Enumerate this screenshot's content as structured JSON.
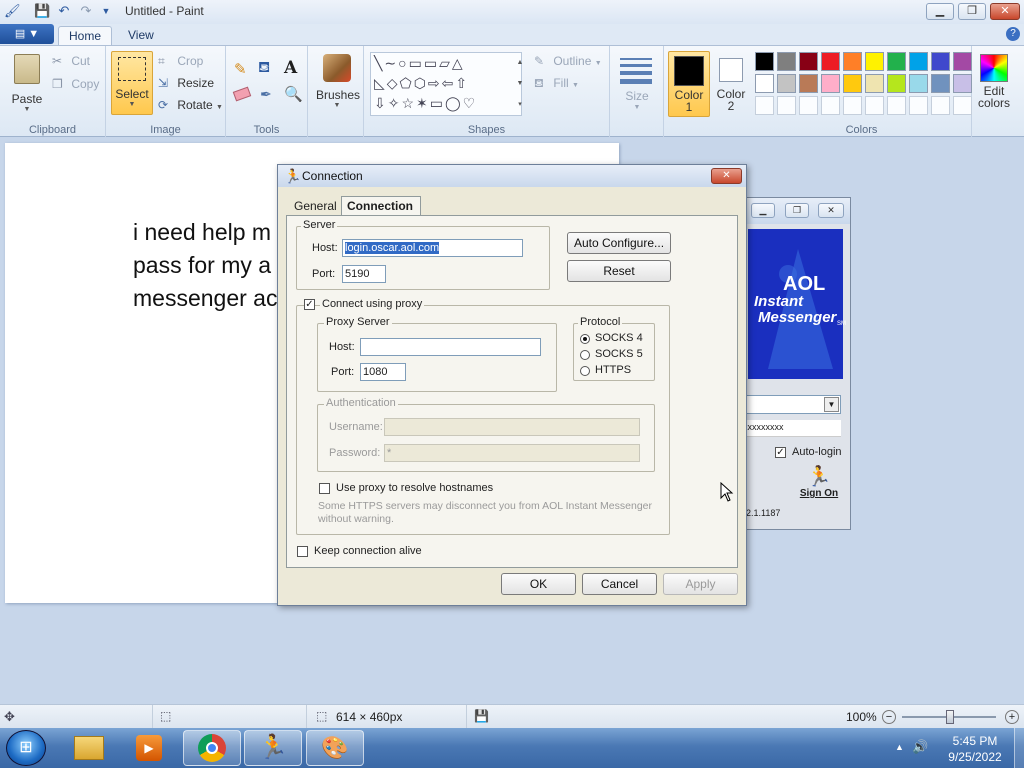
{
  "window": {
    "title": "Untitled - Paint"
  },
  "ribbon": {
    "app_menu": "▼",
    "tabs": [
      "Home",
      "View"
    ],
    "clipboard": {
      "paste": "Paste",
      "cut": "Cut",
      "copy": "Copy",
      "label": "Clipboard"
    },
    "image": {
      "select": "Select",
      "crop": "Crop",
      "resize": "Resize",
      "rotate": "Rotate",
      "label": "Image"
    },
    "tools": {
      "label": "Tools",
      "text_tool": "A"
    },
    "brushes": {
      "label": "Brushes"
    },
    "shapes": {
      "outline": "Outline",
      "fill": "Fill",
      "label": "Shapes"
    },
    "size": {
      "label": "Size"
    },
    "color1": {
      "label1": "Color",
      "label2": "1"
    },
    "color2": {
      "label1": "Color",
      "label2": "2"
    },
    "colors": {
      "label": "Colors",
      "edit1": "Edit",
      "edit2": "colors",
      "row1": [
        "#000000",
        "#7f7f7f",
        "#880015",
        "#ed1c24",
        "#ff7f27",
        "#fff200",
        "#22b14c",
        "#00a2e8",
        "#3f48cc",
        "#a349a4"
      ],
      "row2": [
        "#ffffff",
        "#c3c3c3",
        "#b97a57",
        "#ffaec9",
        "#ffc90e",
        "#efe4b0",
        "#b5e61d",
        "#99d9ea",
        "#7092be",
        "#c8bfe7"
      ]
    },
    "selected_color1": "#000000",
    "selected_color2": "#ffffff"
  },
  "canvas": {
    "lines": [
      "i need help m",
      "pass for my a",
      "messenger ac"
    ]
  },
  "aim": {
    "logo1": "AOL",
    "logo2": "Instant",
    "logo3": "Messenger",
    "logo_sm": "SM",
    "password": "xxxxxxxxx",
    "autologin": "Auto-login",
    "signon": "Sign On",
    "version": "2.1.1187"
  },
  "dialog": {
    "title": "Connection",
    "tabs": [
      "General",
      "Connection"
    ],
    "server_legend": "Server",
    "host_label": "Host:",
    "host_value": "login.oscar.aol.com",
    "port_label": "Port:",
    "port_value": "5190",
    "auto_configure": "Auto Configure...",
    "reset": "Reset",
    "use_proxy": "Connect using proxy",
    "proxy_legend": "Proxy Server",
    "proxy_host_label": "Host:",
    "proxy_host_value": "",
    "proxy_port_label": "Port:",
    "proxy_port_value": "1080",
    "protocol_legend": "Protocol",
    "protocols": [
      "SOCKS 4",
      "SOCKS 5",
      "HTTPS"
    ],
    "auth_legend": "Authentication",
    "username_label": "Username:",
    "password_label": "Password:",
    "password_value": "*",
    "resolve_label": "Use proxy to resolve hostnames",
    "note": "Some HTTPS servers may disconnect you from AOL Instant Messenger without warning.",
    "keepalive_label": "Keep connection alive",
    "ok": "OK",
    "cancel": "Cancel",
    "apply": "Apply"
  },
  "statusbar": {
    "size": "614 × 460px",
    "zoom": "100%"
  },
  "taskbar": {
    "time": "5:45 PM",
    "date": "9/25/2022"
  }
}
